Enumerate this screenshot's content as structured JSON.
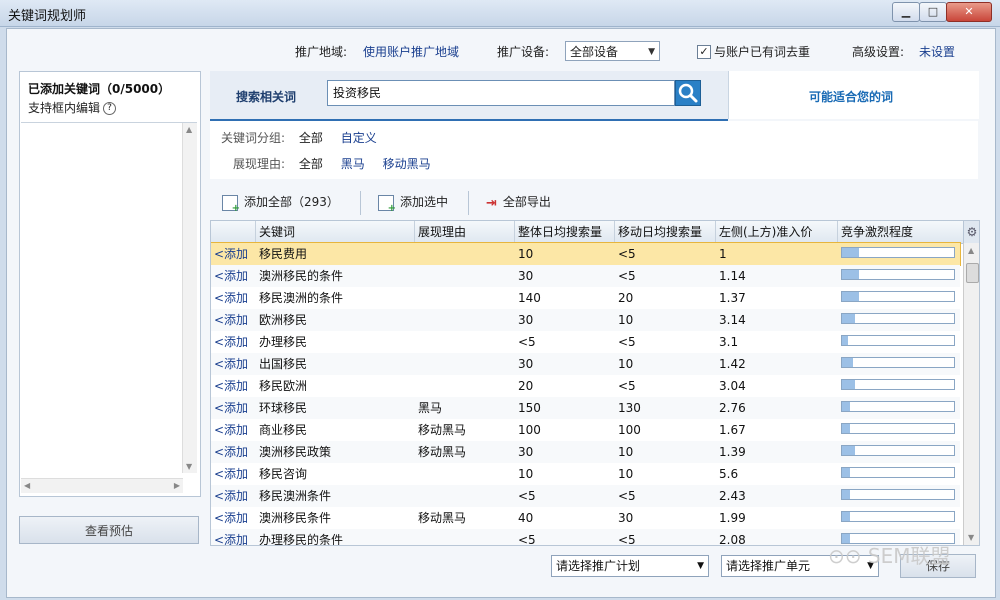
{
  "window": {
    "title": "关键词规划师"
  },
  "top": {
    "region_label": "推广地域:",
    "region_value": "使用账户推广地域",
    "device_label": "推广设备:",
    "device_value": "全部设备",
    "dedupe_label": "与账户已有词去重",
    "dedupe_checked": "✓",
    "advanced_label": "高级设置:",
    "advanced_value": "未设置"
  },
  "left": {
    "title": "已添加关键词（0/5000）",
    "subtitle": "支持框内编辑",
    "preview_button": "查看预估"
  },
  "search": {
    "label": "搜索相关词",
    "query": "投资移民",
    "suggest_tab": "可能适合您的词"
  },
  "filters": {
    "group_label": "关键词分组:",
    "group_items": [
      "全部",
      "自定义"
    ],
    "reason_label": "展现理由:",
    "reason_items": [
      "全部",
      "黑马",
      "移动黑马"
    ]
  },
  "actions": {
    "add_all": "添加全部（293）",
    "add_selected": "添加选中",
    "export_all": "全部导出"
  },
  "table": {
    "columns": [
      "关键词",
      "展现理由",
      "整体日均搜索量",
      "移动日均搜索量",
      "左侧(上方)准入价",
      "竞争激烈程度"
    ],
    "add_label": "<添加",
    "rows": [
      {
        "kw": "移民费用",
        "reason": "",
        "total": "10",
        "mobile": "<5",
        "price": "1",
        "comp": 0.15
      },
      {
        "kw": "澳洲移民的条件",
        "reason": "",
        "total": "30",
        "mobile": "<5",
        "price": "1.14",
        "comp": 0.15
      },
      {
        "kw": "移民澳洲的条件",
        "reason": "",
        "total": "140",
        "mobile": "20",
        "price": "1.37",
        "comp": 0.15
      },
      {
        "kw": "欧洲移民",
        "reason": "",
        "total": "30",
        "mobile": "10",
        "price": "3.14",
        "comp": 0.12
      },
      {
        "kw": "办理移民",
        "reason": "",
        "total": "<5",
        "mobile": "<5",
        "price": "3.1",
        "comp": 0.05
      },
      {
        "kw": "出国移民",
        "reason": "",
        "total": "30",
        "mobile": "10",
        "price": "1.42",
        "comp": 0.1
      },
      {
        "kw": "移民欧洲",
        "reason": "",
        "total": "20",
        "mobile": "<5",
        "price": "3.04",
        "comp": 0.12
      },
      {
        "kw": "环球移民",
        "reason": "黑马",
        "total": "150",
        "mobile": "130",
        "price": "2.76",
        "comp": 0.07
      },
      {
        "kw": "商业移民",
        "reason": "移动黑马",
        "total": "100",
        "mobile": "100",
        "price": "1.67",
        "comp": 0.07
      },
      {
        "kw": "澳洲移民政策",
        "reason": "移动黑马",
        "total": "30",
        "mobile": "10",
        "price": "1.39",
        "comp": 0.12
      },
      {
        "kw": "移民咨询",
        "reason": "",
        "total": "10",
        "mobile": "10",
        "price": "5.6",
        "comp": 0.07
      },
      {
        "kw": "移民澳洲条件",
        "reason": "",
        "total": "<5",
        "mobile": "<5",
        "price": "2.43",
        "comp": 0.07
      },
      {
        "kw": "澳洲移民条件",
        "reason": "移动黑马",
        "total": "40",
        "mobile": "30",
        "price": "1.99",
        "comp": 0.07
      },
      {
        "kw": "办理移民的条件",
        "reason": "",
        "total": "<5",
        "mobile": "<5",
        "price": "2.08",
        "comp": 0.07
      }
    ]
  },
  "bottom": {
    "plan_select": "请选择推广计划",
    "unit_select": "请选择推广单元",
    "save_button": "保存"
  },
  "watermark": "SEM联盟"
}
